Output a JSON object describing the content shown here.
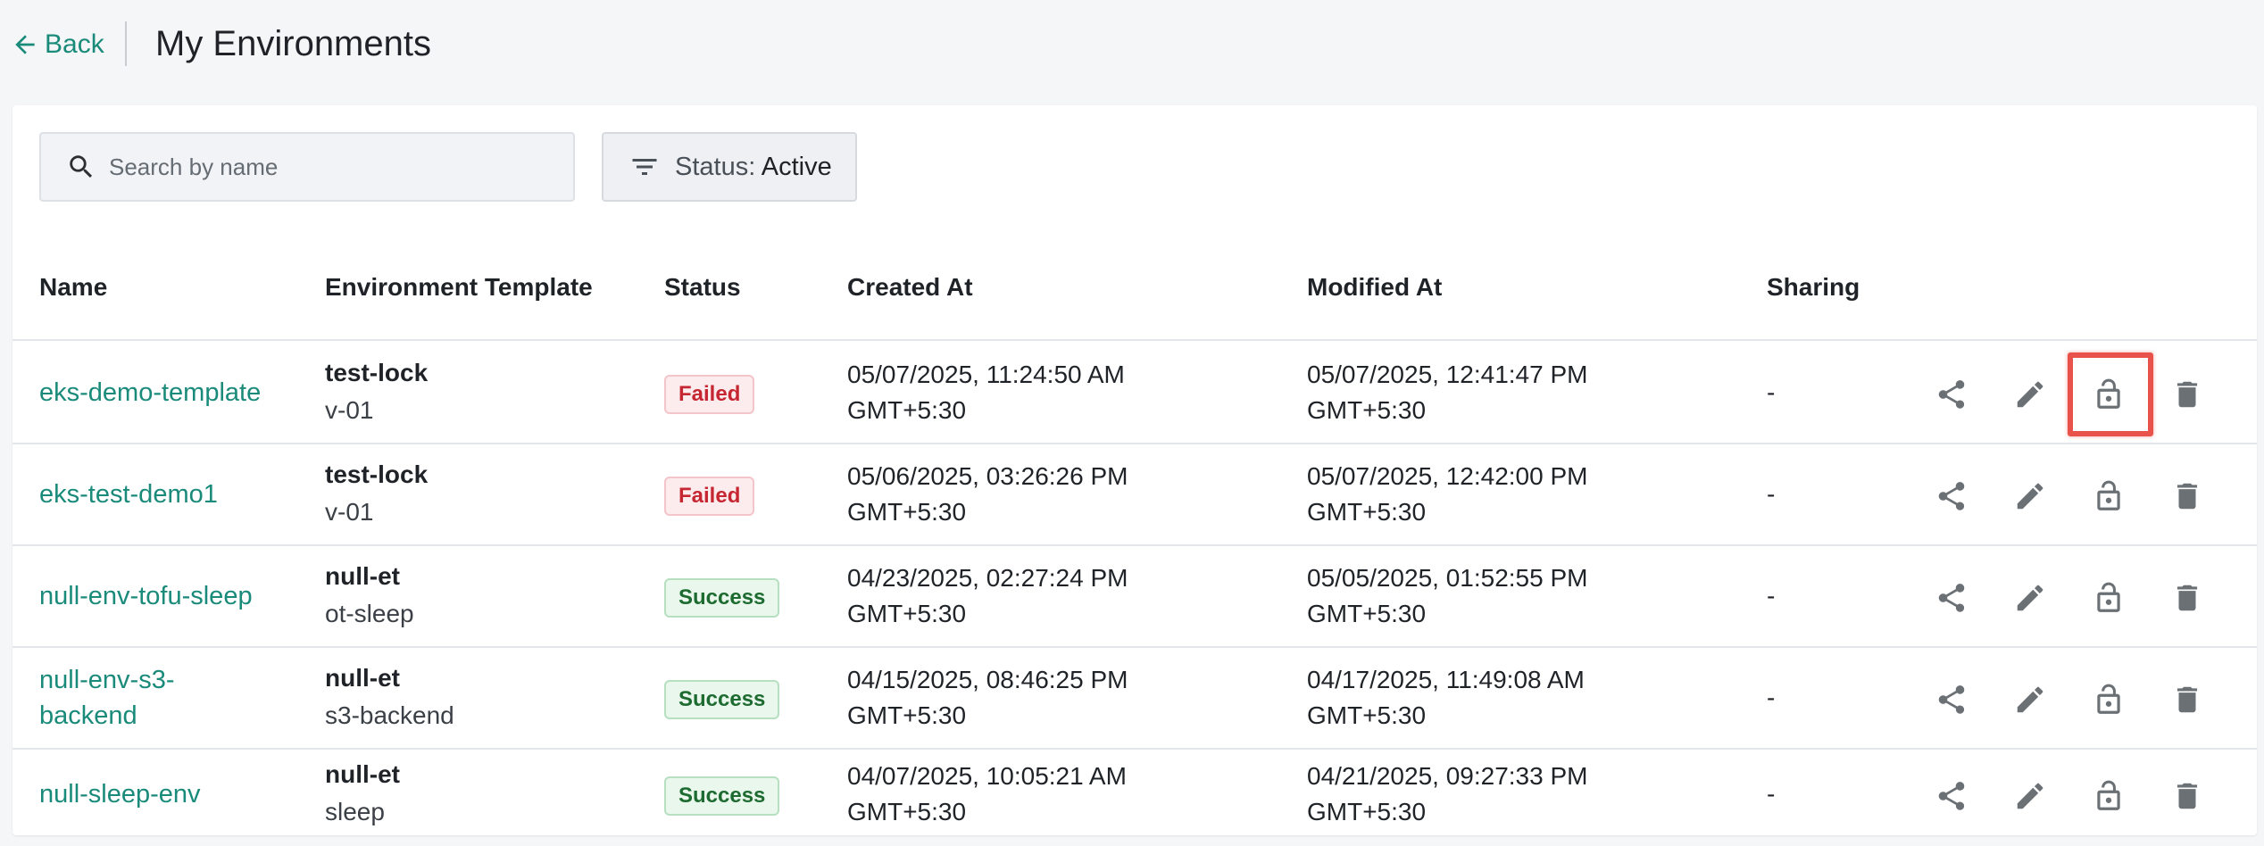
{
  "header": {
    "back_label": "Back",
    "title": "My Environments"
  },
  "toolbar": {
    "search_placeholder": "Search by name",
    "search_value": "",
    "filter_key": "Status:",
    "filter_value": "Active"
  },
  "table": {
    "columns": [
      "Name",
      "Environment Template",
      "Status",
      "Created At",
      "Modified At",
      "Sharing"
    ],
    "rows": [
      {
        "name_line1": "eks-demo-template",
        "name_line2": "",
        "template": "test-lock",
        "version": "v-01",
        "status": "Failed",
        "created_date": "05/07/2025, 11:24:50 AM",
        "created_tz": "GMT+5:30",
        "modified_date": "05/07/2025, 12:41:47 PM",
        "modified_tz": "GMT+5:30",
        "sharing": "-"
      },
      {
        "name_line1": "eks-test-demo1",
        "name_line2": "",
        "template": "test-lock",
        "version": "v-01",
        "status": "Failed",
        "created_date": "05/06/2025, 03:26:26 PM",
        "created_tz": "GMT+5:30",
        "modified_date": "05/07/2025, 12:42:00 PM",
        "modified_tz": "GMT+5:30",
        "sharing": "-"
      },
      {
        "name_line1": "null-env-tofu-sleep",
        "name_line2": "",
        "template": "null-et",
        "version": "ot-sleep",
        "status": "Success",
        "created_date": "04/23/2025, 02:27:24 PM",
        "created_tz": "GMT+5:30",
        "modified_date": "05/05/2025, 01:52:55 PM",
        "modified_tz": "GMT+5:30",
        "sharing": "-"
      },
      {
        "name_line1": "null-env-s3-",
        "name_line2": "backend",
        "template": "null-et",
        "version": "s3-backend",
        "status": "Success",
        "created_date": "04/15/2025, 08:46:25 PM",
        "created_tz": "GMT+5:30",
        "modified_date": "04/17/2025, 11:49:08 AM",
        "modified_tz": "GMT+5:30",
        "sharing": "-"
      },
      {
        "name_line1": "null-sleep-env",
        "name_line2": "",
        "template": "null-et",
        "version": "sleep",
        "status": "Success",
        "created_date": "04/07/2025, 10:05:21 AM",
        "created_tz": "GMT+5:30",
        "modified_date": "04/21/2025, 09:27:33 PM",
        "modified_tz": "GMT+5:30",
        "sharing": "-"
      }
    ],
    "row_actions": [
      "share-icon",
      "edit-icon",
      "lock-icon",
      "delete-icon"
    ]
  },
  "colors": {
    "accent": "#1a8a7a",
    "failed": "#c62631",
    "success": "#1d6b30",
    "highlight": "#e8524a",
    "icon": "#6b7075"
  }
}
